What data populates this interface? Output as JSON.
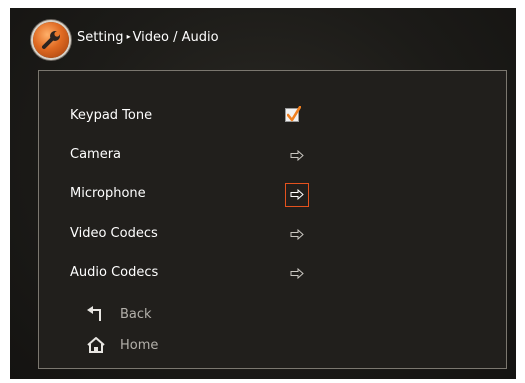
{
  "header": {
    "breadcrumb_root": "Setting",
    "separator": "▸",
    "breadcrumb_current": "Video / Audio",
    "icon": "wrench-icon"
  },
  "menu": [
    {
      "label": "Keypad Tone",
      "control": "checkbox",
      "checked": true
    },
    {
      "label": "Camera",
      "control": "arrow",
      "focused": false
    },
    {
      "label": "Microphone",
      "control": "arrow",
      "focused": true
    },
    {
      "label": "Video Codecs",
      "control": "arrow",
      "focused": false
    },
    {
      "label": "Audio Codecs",
      "control": "arrow",
      "focused": false
    }
  ],
  "nav": {
    "back_label": "Back",
    "home_label": "Home"
  },
  "colors": {
    "accent": "#e4521e",
    "checkmark": "#f07f1e",
    "panel_border": "#7b776f"
  }
}
